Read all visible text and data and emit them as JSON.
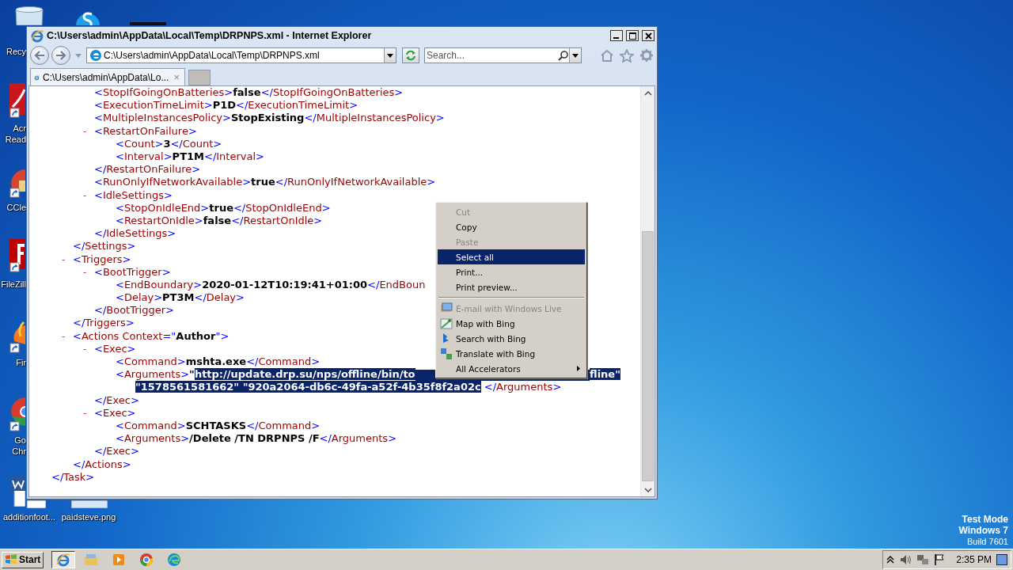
{
  "window": {
    "title": "C:\\Users\\admin\\AppData\\Local\\Temp\\DRPNPS.xml - Internet Explorer"
  },
  "address_bar": {
    "value": "C:\\Users\\admin\\AppData\\Local\\Temp\\DRPNPS.xml"
  },
  "search": {
    "placeholder": "Search..."
  },
  "tabs": [
    {
      "label": "C:\\Users\\admin\\AppData\\Lo...",
      "close": "×",
      "selected": true
    }
  ],
  "xml_tree": [
    {
      "children": [
        {
          "children": [
            {
              "parts": [
                {
                  "kind": "punct",
                  "text": "<"
                },
                {
                  "kind": "name",
                  "text": "StopIfGoingOnBatteries"
                },
                {
                  "kind": "punct",
                  "text": ">"
                },
                {
                  "kind": "value",
                  "text": "false"
                },
                {
                  "kind": "punct",
                  "text": "</"
                },
                {
                  "kind": "name",
                  "text": "StopIfGoingOnBatteries"
                },
                {
                  "kind": "punct",
                  "text": ">"
                }
              ]
            },
            {
              "parts": [
                {
                  "kind": "punct",
                  "text": "<"
                },
                {
                  "kind": "name",
                  "text": "ExecutionTimeLimit"
                },
                {
                  "kind": "punct",
                  "text": ">"
                },
                {
                  "kind": "value",
                  "text": "P1D"
                },
                {
                  "kind": "punct",
                  "text": "</"
                },
                {
                  "kind": "name",
                  "text": "ExecutionTimeLimit"
                },
                {
                  "kind": "punct",
                  "text": ">"
                }
              ]
            },
            {
              "parts": [
                {
                  "kind": "punct",
                  "text": "<"
                },
                {
                  "kind": "name",
                  "text": "MultipleInstancesPolicy"
                },
                {
                  "kind": "punct",
                  "text": ">"
                },
                {
                  "kind": "value",
                  "text": "StopExisting"
                },
                {
                  "kind": "punct",
                  "text": "</"
                },
                {
                  "kind": "name",
                  "text": "MultipleInstancesPolicy"
                },
                {
                  "kind": "punct",
                  "text": ">"
                }
              ]
            },
            {
              "toggle": "-",
              "parts": [
                {
                  "kind": "punct",
                  "text": "<"
                },
                {
                  "kind": "name",
                  "text": "RestartOnFailure"
                },
                {
                  "kind": "punct",
                  "text": ">"
                }
              ],
              "children": [
                {
                  "parts": [
                    {
                      "kind": "punct",
                      "text": "<"
                    },
                    {
                      "kind": "name",
                      "text": "Count"
                    },
                    {
                      "kind": "punct",
                      "text": ">"
                    },
                    {
                      "kind": "value",
                      "text": "3"
                    },
                    {
                      "kind": "punct",
                      "text": "</"
                    },
                    {
                      "kind": "name",
                      "text": "Count"
                    },
                    {
                      "kind": "punct",
                      "text": ">"
                    }
                  ]
                },
                {
                  "parts": [
                    {
                      "kind": "punct",
                      "text": "<"
                    },
                    {
                      "kind": "name",
                      "text": "Interval"
                    },
                    {
                      "kind": "punct",
                      "text": ">"
                    },
                    {
                      "kind": "value",
                      "text": "PT1M"
                    },
                    {
                      "kind": "punct",
                      "text": "</"
                    },
                    {
                      "kind": "name",
                      "text": "Interval"
                    },
                    {
                      "kind": "punct",
                      "text": ">"
                    }
                  ]
                }
              ]
            },
            {
              "parts": [
                {
                  "kind": "punct",
                  "text": "</"
                },
                {
                  "kind": "name",
                  "text": "RestartOnFailure"
                },
                {
                  "kind": "punct",
                  "text": ">"
                }
              ]
            },
            {
              "parts": [
                {
                  "kind": "punct",
                  "text": "<"
                },
                {
                  "kind": "name",
                  "text": "RunOnlyIfNetworkAvailable"
                },
                {
                  "kind": "punct",
                  "text": ">"
                },
                {
                  "kind": "value",
                  "text": "true"
                },
                {
                  "kind": "punct",
                  "text": "</"
                },
                {
                  "kind": "name",
                  "text": "RunOnlyIfNetworkAvailable"
                },
                {
                  "kind": "punct",
                  "text": ">"
                }
              ]
            },
            {
              "toggle": "-",
              "parts": [
                {
                  "kind": "punct",
                  "text": "<"
                },
                {
                  "kind": "name",
                  "text": "IdleSettings"
                },
                {
                  "kind": "punct",
                  "text": ">"
                }
              ],
              "children": [
                {
                  "parts": [
                    {
                      "kind": "punct",
                      "text": "<"
                    },
                    {
                      "kind": "name",
                      "text": "StopOnIdleEnd"
                    },
                    {
                      "kind": "punct",
                      "text": ">"
                    },
                    {
                      "kind": "value",
                      "text": "true"
                    },
                    {
                      "kind": "punct",
                      "text": "</"
                    },
                    {
                      "kind": "name",
                      "text": "StopOnIdleEnd"
                    },
                    {
                      "kind": "punct",
                      "text": ">"
                    }
                  ]
                },
                {
                  "parts": [
                    {
                      "kind": "punct",
                      "text": "<"
                    },
                    {
                      "kind": "name",
                      "text": "RestartOnIdle"
                    },
                    {
                      "kind": "punct",
                      "text": ">"
                    },
                    {
                      "kind": "value",
                      "text": "false"
                    },
                    {
                      "kind": "punct",
                      "text": "</"
                    },
                    {
                      "kind": "name",
                      "text": "RestartOnIdle"
                    },
                    {
                      "kind": "punct",
                      "text": ">"
                    }
                  ]
                }
              ]
            },
            {
              "parts": [
                {
                  "kind": "punct",
                  "text": "</"
                },
                {
                  "kind": "name",
                  "text": "IdleSettings"
                },
                {
                  "kind": "punct",
                  "text": ">"
                }
              ]
            }
          ]
        },
        {
          "parts": [
            {
              "kind": "punct",
              "text": "</"
            },
            {
              "kind": "name",
              "text": "Settings"
            },
            {
              "kind": "punct",
              "text": ">"
            }
          ]
        },
        {
          "toggle": "-",
          "parts": [
            {
              "kind": "punct",
              "text": "<"
            },
            {
              "kind": "name",
              "text": "Triggers"
            },
            {
              "kind": "punct",
              "text": ">"
            }
          ],
          "children": [
            {
              "toggle": "-",
              "parts": [
                {
                  "kind": "punct",
                  "text": "<"
                },
                {
                  "kind": "name",
                  "text": "BootTrigger"
                },
                {
                  "kind": "punct",
                  "text": ">"
                }
              ],
              "children": [
                {
                  "parts": [
                    {
                      "kind": "punct",
                      "text": "<"
                    },
                    {
                      "kind": "name",
                      "text": "EndBoundary"
                    },
                    {
                      "kind": "punct",
                      "text": ">"
                    },
                    {
                      "kind": "value",
                      "text": "2020-01-12T10:19:41+01:00"
                    },
                    {
                      "kind": "punct",
                      "text": "</"
                    },
                    {
                      "kind": "name",
                      "text": "EndBoun"
                    }
                  ]
                },
                {
                  "parts": [
                    {
                      "kind": "punct",
                      "text": "<"
                    },
                    {
                      "kind": "name",
                      "text": "Delay"
                    },
                    {
                      "kind": "punct",
                      "text": ">"
                    },
                    {
                      "kind": "value",
                      "text": "PT3M"
                    },
                    {
                      "kind": "punct",
                      "text": "</"
                    },
                    {
                      "kind": "name",
                      "text": "Delay"
                    },
                    {
                      "kind": "punct",
                      "text": ">"
                    }
                  ]
                }
              ]
            },
            {
              "parts": [
                {
                  "kind": "punct",
                  "text": "</"
                },
                {
                  "kind": "name",
                  "text": "BootTrigger"
                },
                {
                  "kind": "punct",
                  "text": ">"
                }
              ]
            }
          ]
        },
        {
          "parts": [
            {
              "kind": "punct",
              "text": "</"
            },
            {
              "kind": "name",
              "text": "Triggers"
            },
            {
              "kind": "punct",
              "text": ">"
            }
          ]
        },
        {
          "toggle": "-",
          "parts": [
            {
              "kind": "punct",
              "text": "<"
            },
            {
              "kind": "name",
              "text": "Actions Context"
            },
            {
              "kind": "punct",
              "text": "=\""
            },
            {
              "kind": "value",
              "text": "Author"
            },
            {
              "kind": "punct",
              "text": "\">"
            }
          ],
          "children": [
            {
              "toggle": "-",
              "parts": [
                {
                  "kind": "punct",
                  "text": "<"
                },
                {
                  "kind": "name",
                  "text": "Exec"
                },
                {
                  "kind": "punct",
                  "text": ">"
                }
              ],
              "children": [
                {
                  "parts": [
                    {
                      "kind": "punct",
                      "text": "<"
                    },
                    {
                      "kind": "name",
                      "text": "Command"
                    },
                    {
                      "kind": "punct",
                      "text": ">"
                    },
                    {
                      "kind": "value",
                      "text": "mshta.exe"
                    },
                    {
                      "kind": "punct",
                      "text": "</"
                    },
                    {
                      "kind": "name",
                      "text": "Command"
                    },
                    {
                      "kind": "punct",
                      "text": ">"
                    }
                  ]
                },
                {
                  "parts": [
                    {
                      "kind": "punct",
                      "text": "<"
                    },
                    {
                      "kind": "name",
                      "text": "Arguments"
                    },
                    {
                      "kind": "punct",
                      "text": ">"
                    },
                    {
                      "kind": "value",
                      "text": "\"",
                      "selected": false
                    },
                    {
                      "kind": "value",
                      "text": "http://update.drp.su/nps/offline/bin/to",
                      "selected": true
                    },
                    {
                      "kind": "hidden"
                    },
                    {
                      "kind": "value",
                      "text": "fline\"",
                      "selected": true
                    }
                  ],
                  "continued": [
                    {
                      "kind": "value",
                      "text": "\"1578561581662\" \"920a2064-db6c-49fa-a52f-4b35f8f2a02c",
                      "selected": true
                    },
                    {
                      "kind": "punct",
                      "text": " </"
                    },
                    {
                      "kind": "name",
                      "text": "Arguments"
                    },
                    {
                      "kind": "punct",
                      "text": ">"
                    }
                  ]
                }
              ]
            },
            {
              "parts": [
                {
                  "kind": "punct",
                  "text": "</"
                },
                {
                  "kind": "name",
                  "text": "Exec"
                },
                {
                  "kind": "punct",
                  "text": ">"
                }
              ]
            },
            {
              "toggle": "-",
              "parts": [
                {
                  "kind": "punct",
                  "text": "<"
                },
                {
                  "kind": "name",
                  "text": "Exec"
                },
                {
                  "kind": "punct",
                  "text": ">"
                }
              ],
              "children": [
                {
                  "parts": [
                    {
                      "kind": "punct",
                      "text": "<"
                    },
                    {
                      "kind": "name",
                      "text": "Command"
                    },
                    {
                      "kind": "punct",
                      "text": ">"
                    },
                    {
                      "kind": "value",
                      "text": "SCHTASKS"
                    },
                    {
                      "kind": "punct",
                      "text": "</"
                    },
                    {
                      "kind": "name",
                      "text": "Command"
                    },
                    {
                      "kind": "punct",
                      "text": ">"
                    }
                  ]
                },
                {
                  "parts": [
                    {
                      "kind": "punct",
                      "text": "<"
                    },
                    {
                      "kind": "name",
                      "text": "Arguments"
                    },
                    {
                      "kind": "punct",
                      "text": ">"
                    },
                    {
                      "kind": "value",
                      "text": "/Delete /TN DRPNPS /F"
                    },
                    {
                      "kind": "punct",
                      "text": "</"
                    },
                    {
                      "kind": "name",
                      "text": "Arguments"
                    },
                    {
                      "kind": "punct",
                      "text": ">"
                    }
                  ]
                }
              ]
            },
            {
              "parts": [
                {
                  "kind": "punct",
                  "text": "</"
                },
                {
                  "kind": "name",
                  "text": "Exec"
                },
                {
                  "kind": "punct",
                  "text": ">"
                }
              ]
            }
          ]
        },
        {
          "parts": [
            {
              "kind": "punct",
              "text": "</"
            },
            {
              "kind": "name",
              "text": "Actions"
            },
            {
              "kind": "punct",
              "text": ">"
            }
          ]
        }
      ]
    },
    {
      "parts": [
        {
          "kind": "punct",
          "text": "</"
        },
        {
          "kind": "name",
          "text": "Task"
        },
        {
          "kind": "punct",
          "text": ">"
        }
      ]
    }
  ],
  "context_menu": {
    "groups": [
      [
        {
          "label": "Cut",
          "disabled": true,
          "selected": false
        },
        {
          "label": "Copy",
          "disabled": false,
          "selected": false
        },
        {
          "label": "Paste",
          "disabled": true,
          "selected": false
        },
        {
          "label": "Select all",
          "disabled": false,
          "selected": true
        },
        {
          "label": "Print...",
          "disabled": false,
          "selected": false
        },
        {
          "label": "Print preview...",
          "disabled": false,
          "selected": false
        }
      ],
      [
        {
          "label": "E-mail with Windows Live",
          "disabled": true,
          "selected": false
        },
        {
          "label": "Map with Bing",
          "disabled": false,
          "selected": false
        },
        {
          "label": "Search with Bing",
          "disabled": false,
          "selected": false
        },
        {
          "label": "Translate with Bing",
          "disabled": false,
          "selected": false
        },
        {
          "label": "All Accelerators",
          "disabled": false,
          "selected": false,
          "submenu": true
        }
      ]
    ]
  },
  "desktop_icons": [
    {
      "label_lines": [
        "Recy"
      ]
    },
    {
      "label_lines": [
        "Acr",
        "Read"
      ]
    },
    {
      "label_lines": [
        "CCle"
      ]
    },
    {
      "label_lines": [
        "FileZill"
      ]
    },
    {
      "label_lines": [
        "Fir"
      ]
    },
    {
      "label_lines": [
        "Go",
        "Chr"
      ]
    },
    {
      "label_lines": [
        "additionfoot..."
      ]
    },
    {
      "label_lines": [
        "paidsteve.png"
      ]
    }
  ],
  "system_text": [
    "Test Mode",
    "Windows 7",
    "Build 7601"
  ],
  "taskbar": {
    "start": "Start",
    "apps": [
      {
        "selected": true
      },
      {
        "selected": false
      },
      {
        "selected": false
      },
      {
        "selected": false
      },
      {
        "selected": false
      }
    ],
    "clock": "2:35 PM"
  }
}
